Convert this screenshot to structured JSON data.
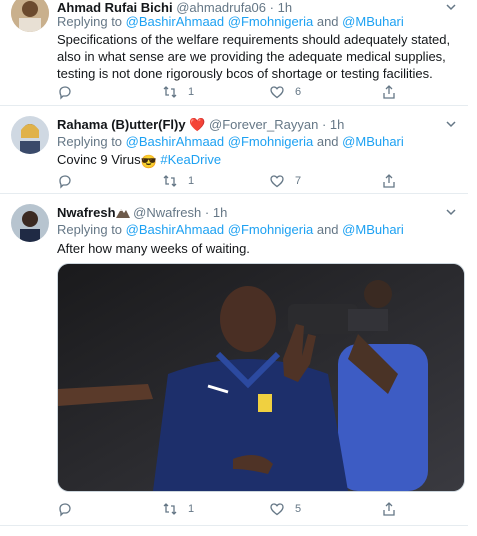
{
  "tweets": [
    {
      "name": "Ahmad Rufai Bichi",
      "handle": "@ahmadrufa06",
      "dot": "·",
      "time": "1h",
      "replying_prefix": "Replying to",
      "mention1": "@BashirAhmaad",
      "mention2": "@Fmohnigeria",
      "and": "and",
      "mention3": "@MBuhari",
      "text": "Specifications of the welfare requirements should adequately stated, also in what sense are we providing the adequate medical supplies, testing is not done rigorously bcos of shortage or testing facilities.",
      "retweets": "1",
      "likes": "6"
    },
    {
      "name": "Rahama (B)utter(Fl)y",
      "name_heart": "❤️",
      "handle": "@Forever_Rayyan",
      "dot": "·",
      "time": "1h",
      "replying_prefix": "Replying to",
      "mention1": "@BashirAhmaad",
      "mention2": "@Fmohnigeria",
      "and": "and",
      "mention3": "@MBuhari",
      "text": "Covinc 9 Virus",
      "emoji": "😎",
      "hashtag": "#KeaDrive",
      "retweets": "1",
      "likes": "7"
    },
    {
      "name": "Nwafresh",
      "handle": "@Nwafresh",
      "dot": "·",
      "time": "1h",
      "replying_prefix": "Replying to",
      "mention1": "@BashirAhmaad",
      "mention2": "@Fmohnigeria",
      "and": "and",
      "mention3": "@MBuhari",
      "text": "After how many weeks of waiting.",
      "retweets": "1",
      "likes": "5"
    }
  ],
  "icons": {
    "reply": "reply-icon",
    "retweet": "retweet-icon",
    "like": "heart-icon",
    "share": "share-icon",
    "more": "chevron-down-icon"
  },
  "colors": {
    "link": "#1da1f2",
    "secondary": "#657786",
    "divider": "#e6ecf0"
  }
}
